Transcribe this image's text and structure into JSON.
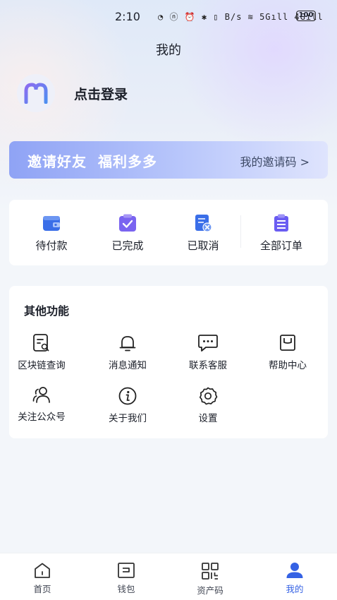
{
  "status_bar": {
    "time": "2:10",
    "icons_text": "◔ ⓝ ⏰ ✱ ▯ B/s ≋ 5Gıll 4Gıll",
    "battery": "100"
  },
  "page_title": "我的",
  "profile": {
    "avatar_icon": "brand-m-logo",
    "login_label": "点击登录"
  },
  "invite_banner": {
    "part1": "邀请好友",
    "part2": "福利多多",
    "my_code_label": "我的邀请码 >"
  },
  "orders": {
    "items": [
      {
        "label": "待付款",
        "icon": "wallet-icon",
        "color": "#3a6ee8"
      },
      {
        "label": "已完成",
        "icon": "check-clipboard-icon",
        "color": "#7a64f0"
      },
      {
        "label": "已取消",
        "icon": "cancel-doc-icon",
        "color": "#3a6ee8"
      },
      {
        "label": "全部订单",
        "icon": "clipboard-list-icon",
        "color": "#6a5cf2"
      }
    ]
  },
  "features": {
    "title": "其他功能",
    "items": [
      {
        "label": "区块链查询",
        "icon": "blockchain-search-icon"
      },
      {
        "label": "消息通知",
        "icon": "bell-icon"
      },
      {
        "label": "联系客服",
        "icon": "chat-icon"
      },
      {
        "label": "帮助中心",
        "icon": "help-book-icon"
      },
      {
        "label": "关注公众号",
        "icon": "users-icon"
      },
      {
        "label": "关于我们",
        "icon": "info-icon"
      },
      {
        "label": "设置",
        "icon": "gear-icon"
      }
    ]
  },
  "tabbar": {
    "items": [
      {
        "label": "首页",
        "icon": "home-icon"
      },
      {
        "label": "钱包",
        "icon": "wallet-tab-icon"
      },
      {
        "label": "资产码",
        "icon": "qr-code-icon"
      },
      {
        "label": "我的",
        "icon": "user-icon",
        "active": true
      }
    ],
    "active_color": "#3562e4"
  }
}
